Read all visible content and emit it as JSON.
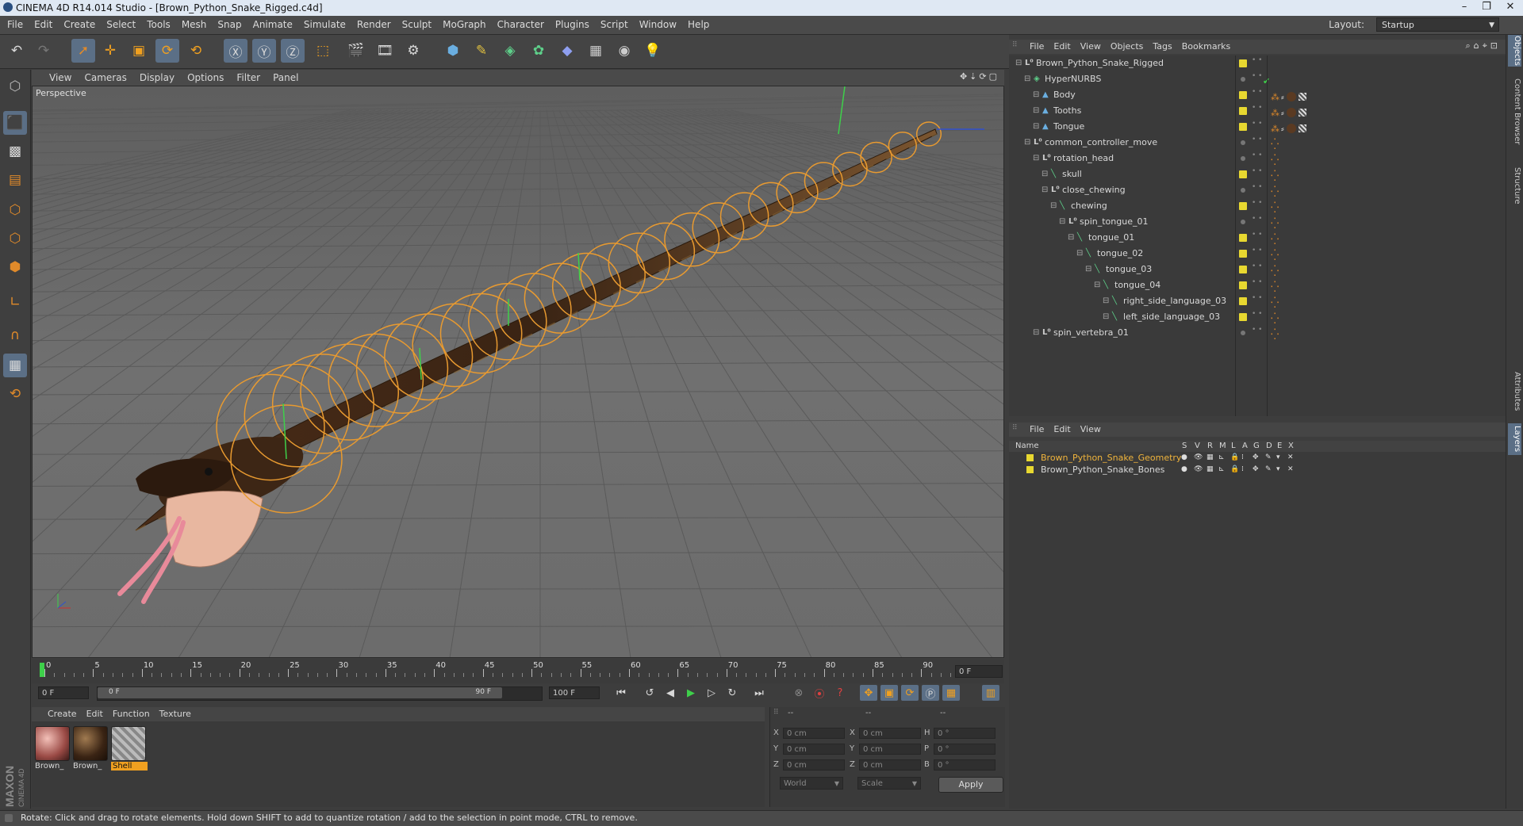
{
  "window": {
    "title": "CINEMA 4D R14.014 Studio - [Brown_Python_Snake_Rigged.c4d]"
  },
  "menubar": [
    "File",
    "Edit",
    "Create",
    "Select",
    "Tools",
    "Mesh",
    "Snap",
    "Animate",
    "Simulate",
    "Render",
    "Sculpt",
    "MoGraph",
    "Character",
    "Plugins",
    "Script",
    "Window",
    "Help"
  ],
  "layout": {
    "label": "Layout:",
    "value": "Startup"
  },
  "viewport": {
    "menu": [
      "View",
      "Cameras",
      "Display",
      "Options",
      "Filter",
      "Panel"
    ],
    "camera_label": "Perspective"
  },
  "timeline": {
    "ticks": [
      "0",
      "5",
      "10",
      "15",
      "20",
      "25",
      "30",
      "35",
      "40",
      "45",
      "50",
      "55",
      "60",
      "65",
      "70",
      "75",
      "80",
      "85",
      "90"
    ],
    "current_frame": "0 F",
    "start_field": "0 F",
    "range_start": "0 F",
    "range_end": "90 F",
    "end_field": "100 F"
  },
  "materials": {
    "menu": [
      "Create",
      "Edit",
      "Function",
      "Texture"
    ],
    "items": [
      {
        "label": "Brown_",
        "kind": "tongue"
      },
      {
        "label": "Brown_",
        "kind": "skin"
      },
      {
        "label": "Shell",
        "kind": "shell",
        "selected": true
      }
    ]
  },
  "coords": {
    "header": [
      "--",
      "--",
      "--"
    ],
    "rows": [
      {
        "a": "X",
        "av": "0 cm",
        "b": "X",
        "bv": "0 cm",
        "c": "H",
        "cv": "0 °"
      },
      {
        "a": "Y",
        "av": "0 cm",
        "b": "Y",
        "bv": "0 cm",
        "c": "P",
        "cv": "0 °"
      },
      {
        "a": "Z",
        "av": "0 cm",
        "b": "Z",
        "bv": "0 cm",
        "c": "B",
        "cv": "0 °"
      }
    ],
    "mode1": "World",
    "mode2": "Scale",
    "apply": "Apply"
  },
  "status": "Rotate: Click and drag to rotate elements. Hold down SHIFT to add to quantize rotation / add to the selection in point mode, CTRL to remove.",
  "object_manager": {
    "menu": [
      "File",
      "Edit",
      "View",
      "Objects",
      "Tags",
      "Bookmarks"
    ],
    "objects": [
      {
        "name": "Brown_Python_Snake_Rigged",
        "depth": 0,
        "icon": "null",
        "vis": true,
        "tags": ""
      },
      {
        "name": "HyperNURBS",
        "depth": 1,
        "icon": "hypernurbs",
        "vis": false,
        "tags": "✔"
      },
      {
        "name": "Body",
        "depth": 2,
        "icon": "poly",
        "vis": true,
        "tags": "mat"
      },
      {
        "name": "Tooths",
        "depth": 2,
        "icon": "poly",
        "vis": true,
        "tags": "mat"
      },
      {
        "name": "Tongue",
        "depth": 2,
        "icon": "poly",
        "vis": true,
        "tags": "mat"
      },
      {
        "name": "common_controller_move",
        "depth": 1,
        "icon": "null",
        "vis": false,
        "tags": "•"
      },
      {
        "name": "rotation_head",
        "depth": 2,
        "icon": "null",
        "vis": false,
        "tags": "•"
      },
      {
        "name": "skull",
        "depth": 3,
        "icon": "bone",
        "vis": true,
        "tags": "•"
      },
      {
        "name": "close_chewing",
        "depth": 3,
        "icon": "null",
        "vis": false,
        "tags": "•"
      },
      {
        "name": "chewing",
        "depth": 4,
        "icon": "bone",
        "vis": true,
        "tags": "•"
      },
      {
        "name": "spin_tongue_01",
        "depth": 5,
        "icon": "null",
        "vis": false,
        "tags": "•"
      },
      {
        "name": "tongue_01",
        "depth": 6,
        "icon": "bone",
        "vis": true,
        "tags": "•"
      },
      {
        "name": "tongue_02",
        "depth": 7,
        "icon": "bone",
        "vis": true,
        "tags": "•"
      },
      {
        "name": "tongue_03",
        "depth": 8,
        "icon": "bone",
        "vis": true,
        "tags": "•"
      },
      {
        "name": "tongue_04",
        "depth": 9,
        "icon": "bone",
        "vis": true,
        "tags": "•"
      },
      {
        "name": "right_side_language_03",
        "depth": 10,
        "icon": "bone",
        "vis": true,
        "tags": "•"
      },
      {
        "name": "left_side_language_03",
        "depth": 10,
        "icon": "bone",
        "vis": true,
        "tags": "•"
      },
      {
        "name": "spin_vertebra_01",
        "depth": 2,
        "icon": "null",
        "vis": false,
        "tags": "•"
      }
    ]
  },
  "layer_manager": {
    "menu": [
      "File",
      "Edit",
      "View"
    ],
    "columns": [
      "Name",
      "S",
      "V",
      "R",
      "M",
      "L",
      "A",
      "G",
      "D",
      "E",
      "X"
    ],
    "layers": [
      {
        "name": "Brown_Python_Snake_Geometry",
        "selected": true
      },
      {
        "name": "Brown_Python_Snake_Bones",
        "selected": false
      }
    ]
  },
  "right_tabs": [
    "Objects",
    "Content Browser",
    "Structure",
    "Attributes",
    "Layers"
  ],
  "brand": {
    "vendor": "MAXON",
    "product": "CINEMA 4D"
  },
  "colors": {
    "accent": "#5b6f86",
    "selected_layer": "#f0b43c",
    "material_selected": "#f0a020",
    "vis_yellow": "#e8d830"
  }
}
